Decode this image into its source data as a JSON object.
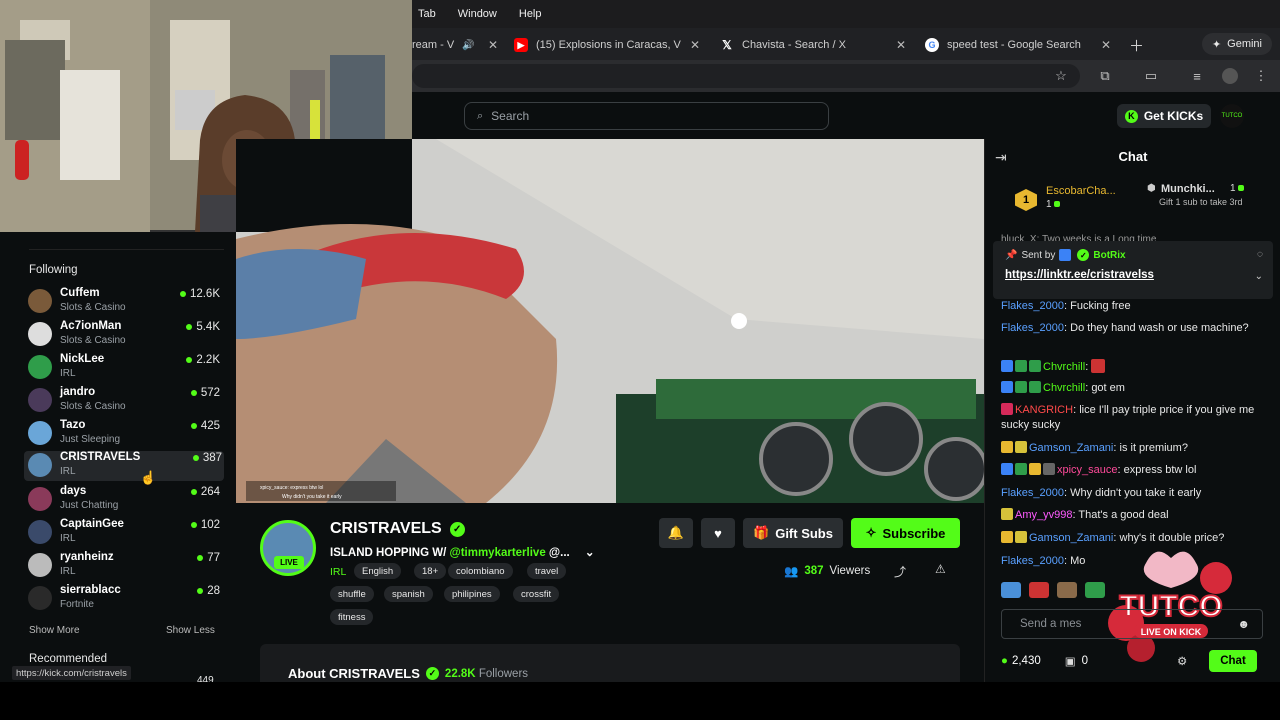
{
  "menu": {
    "items": [
      "Tab",
      "Window",
      "Help"
    ]
  },
  "tabs": [
    {
      "label": "ream - V",
      "icon": "speaker-icon"
    },
    {
      "label": "(15) Explosions in Caracas, V",
      "icon": "youtube-icon"
    },
    {
      "label": "Chavista - Search / X",
      "icon": "x-logo-icon"
    },
    {
      "label": "speed test - Google Search",
      "icon": "google-icon"
    }
  ],
  "gemini_label": "Gemini",
  "search": {
    "placeholder": "Search"
  },
  "get_kicks": "Get KICKs",
  "sidebar": {
    "following_title": "Following",
    "channels": [
      {
        "name": "Cuffem",
        "category": "Slots & Casino",
        "viewers": "12.6K",
        "color": "#7a5a3a"
      },
      {
        "name": "Ac7ionMan",
        "category": "Slots & Casino",
        "viewers": "5.4K",
        "color": "#ddd"
      },
      {
        "name": "NickLee",
        "category": "IRL",
        "viewers": "2.2K",
        "color": "#2f9d4a"
      },
      {
        "name": "jandro",
        "category": "Slots & Casino",
        "viewers": "572",
        "color": "#4a3a5a"
      },
      {
        "name": "Tazo",
        "category": "Just Sleeping",
        "viewers": "425",
        "color": "#6aa6d8"
      },
      {
        "name": "CRISTRAVELS",
        "category": "IRL",
        "viewers": "387",
        "color": "#5a8ab3"
      },
      {
        "name": "days",
        "category": "Just Chatting",
        "viewers": "264",
        "color": "#8a3a5a"
      },
      {
        "name": "CaptainGee",
        "category": "IRL",
        "viewers": "102",
        "color": "#3a4a6a"
      },
      {
        "name": "ryanheinz",
        "category": "IRL",
        "viewers": "77",
        "color": "#bbb"
      },
      {
        "name": "sierrablacc",
        "category": "Fortnite",
        "viewers": "28",
        "color": "#2a2a2a"
      }
    ],
    "show_more": "Show More",
    "show_less": "Show Less",
    "recommended_title": "Recommended",
    "recommended_partial": "449"
  },
  "stream": {
    "channel": "CRISTRAVELS",
    "title_prefix": "ISLAND HOPPING W/ ",
    "title_mention": "@timmykarterlive",
    "title_suffix": " @...",
    "category": "IRL",
    "tags": [
      "English",
      "18+",
      "colombiano",
      "travel",
      "shuffle",
      "spanish",
      "philipines",
      "crossfit",
      "fitness"
    ],
    "live": "LIVE",
    "viewers": "387",
    "viewers_label": "Viewers",
    "gift_subs": "Gift Subs",
    "subscribe": "Subscribe",
    "about_title": "About CRISTRAVELS",
    "followers": "22.8K",
    "followers_label": "Followers",
    "video_overlay_lines": [
      "xpicy_sauce: express btw lol",
      "Why didn't you take it early"
    ]
  },
  "chat": {
    "title": "Chat",
    "leaderboard": [
      {
        "rank": "1",
        "name": "EscobarCha...",
        "count": "1"
      },
      {
        "name": "Munchki...",
        "count": "1",
        "note": "Gift 1 sub to take 3rd"
      }
    ],
    "pinned": {
      "sent_by": "Sent by",
      "bot": "BotRix",
      "link": "https://linktr.ee/cristravelss",
      "peek": "hluck_X: Two weeks is a Long time"
    },
    "messages": [
      {
        "user": "Flakes_2000",
        "color": "#5aa0ff",
        "text": "Fucking free"
      },
      {
        "user": "Flakes_2000",
        "color": "#5aa0ff",
        "text": "Do they hand wash or use machine?"
      },
      {
        "user": "Chvrchill",
        "color": "#53fc18",
        "text": ""
      },
      {
        "user": "Chvrchill",
        "color": "#53fc18",
        "text": "got em"
      },
      {
        "user": "KANGRICH",
        "color": "#ff4a4a",
        "text": "lice I'll pay triple price if you give me sucky sucky"
      },
      {
        "user": "Gamson_Zamani",
        "color": "#5aa0ff",
        "text": "is it premium?"
      },
      {
        "user": "xpicy_sauce",
        "color": "#ff4a9a",
        "text": "express btw lol"
      },
      {
        "user": "Flakes_2000",
        "color": "#5aa0ff",
        "text": "Why didn't you take it early"
      },
      {
        "user": "Amy_yv998",
        "color": "#ff5aff",
        "text": "That's a good deal"
      },
      {
        "user": "Gamson_Zamani",
        "color": "#5aa0ff",
        "text": "why's it double price?"
      },
      {
        "user": "Flakes_2000",
        "color": "#5aa0ff",
        "text": "Mo"
      }
    ],
    "input_placeholder": "Send a mes",
    "kicks_count": "2,430",
    "gift_count": "0",
    "send_label": "Chat",
    "sticker_text": "TUTCO",
    "sticker_sub": "LIVE ON KICK"
  },
  "status_url": "https://kick.com/cristravels",
  "colors": {
    "kick_green": "#53fc18",
    "bg": "#0b0e0f"
  }
}
